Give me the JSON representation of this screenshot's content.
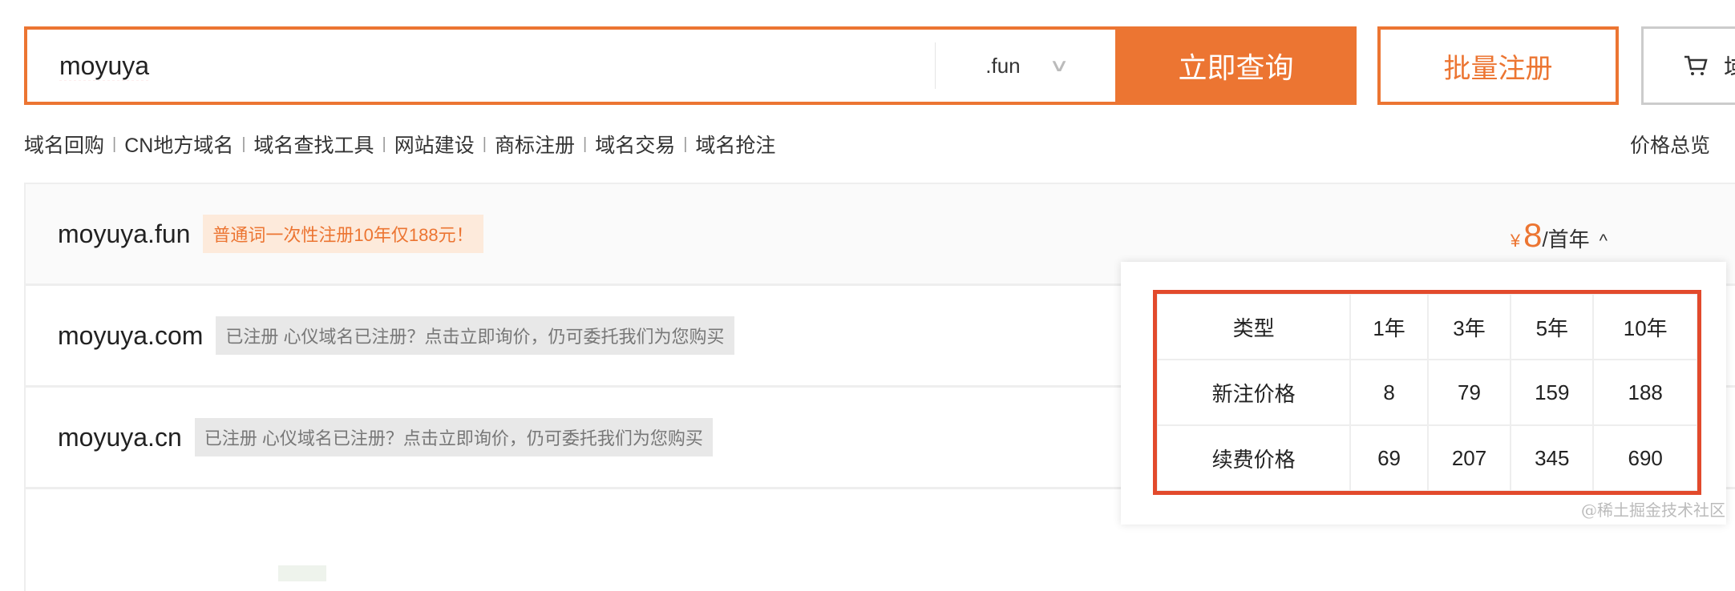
{
  "search": {
    "value": "moyuya",
    "suffix": ".fun",
    "query_label": "立即查询"
  },
  "batch_label": "批量注册",
  "cart_label": "域",
  "nav": [
    "域名回购",
    "CN地方域名",
    "域名查找工具",
    "网站建设",
    "商标注册",
    "域名交易",
    "域名抢注"
  ],
  "nav_sep": "|",
  "price_overview": "价格总览",
  "results": [
    {
      "domain": "moyuya.fun",
      "tag": "普通词一次性注册10年仅188元！"
    },
    {
      "domain": "moyuya.com",
      "tag": "已注册 心仪域名已注册？点击立即询价，仍可委托我们为您购买"
    },
    {
      "domain": "moyuya.cn",
      "tag": "已注册 心仪域名已注册？点击立即询价，仍可委托我们为您购买"
    }
  ],
  "price": {
    "currency": "¥",
    "value": "8",
    "unit": "/首年",
    "caret": "^"
  },
  "price_table": {
    "header": [
      "类型",
      "1年",
      "3年",
      "5年",
      "10年"
    ],
    "rows": [
      [
        "新注价格",
        "8",
        "79",
        "159",
        "188"
      ],
      [
        "续费价格",
        "69",
        "207",
        "345",
        "690"
      ]
    ]
  },
  "watermark": "@稀土掘金技术社区",
  "colors": {
    "accent": "#ec7532",
    "highlight": "#e24a2c"
  }
}
